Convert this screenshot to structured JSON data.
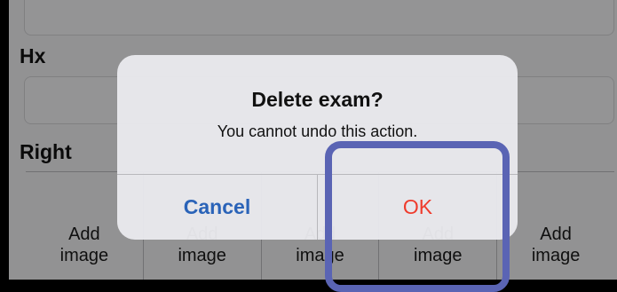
{
  "form": {
    "hx_label": "Hx",
    "right_label": "Right",
    "image_cells": [
      "Add\nimage",
      "Add\nimage",
      "Add\nimage",
      "Add\nimage",
      "Add\nimage"
    ]
  },
  "alert": {
    "title": "Delete exam?",
    "message": "You cannot undo this action.",
    "cancel_label": "Cancel",
    "ok_label": "OK"
  },
  "colors": {
    "cancel": "#2a63b8",
    "ok": "#ef3b2c",
    "highlight": "#5a64b4"
  }
}
